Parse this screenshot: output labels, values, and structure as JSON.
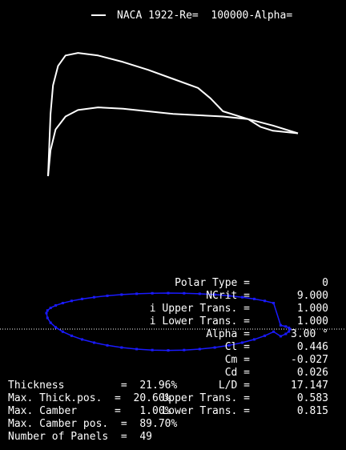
{
  "legend": {
    "label": "NACA 1922-Re=  100000-Alpha="
  },
  "colors": {
    "curve": "#ffffff",
    "airfoil": "#1a1aff",
    "chord_line": "#ffffff",
    "background": "#000000"
  },
  "chart_data": {
    "type": "line",
    "series": [
      {
        "values": [
          [
            0.0,
            0.0
          ],
          [
            0.01,
            0.48
          ],
          [
            0.02,
            0.7
          ],
          [
            0.04,
            0.85
          ],
          [
            0.07,
            0.93
          ],
          [
            0.12,
            0.95
          ],
          [
            0.2,
            0.93
          ],
          [
            0.3,
            0.88
          ],
          [
            0.4,
            0.82
          ],
          [
            0.5,
            0.75
          ],
          [
            0.6,
            0.68
          ],
          [
            0.65,
            0.6
          ],
          [
            0.7,
            0.5
          ],
          [
            0.8,
            0.44
          ],
          [
            0.9,
            0.39
          ],
          [
            1.0,
            0.33
          ]
        ]
      },
      {
        "values": [
          [
            0.0,
            0.0
          ],
          [
            0.01,
            0.2
          ],
          [
            0.03,
            0.36
          ],
          [
            0.07,
            0.46
          ],
          [
            0.12,
            0.51
          ],
          [
            0.2,
            0.53
          ],
          [
            0.3,
            0.52
          ],
          [
            0.4,
            0.5
          ],
          [
            0.5,
            0.48
          ],
          [
            0.6,
            0.47
          ],
          [
            0.7,
            0.46
          ],
          [
            0.8,
            0.44
          ],
          [
            0.85,
            0.38
          ],
          [
            0.9,
            0.35
          ],
          [
            1.0,
            0.33
          ]
        ]
      }
    ]
  },
  "stats": {
    "polar_type": {
      "label": "Polar Type =",
      "value": "0"
    },
    "ncrit": {
      "label": "NCrit =",
      "value": "9.000"
    },
    "upper_trans": {
      "label": "i Upper Trans. =",
      "value": "1.000"
    },
    "lower_trans": {
      "label": "i Lower Trans. =",
      "value": "1.000"
    },
    "alpha": {
      "label": "Alpha =",
      "value": "3.00 °"
    },
    "cl": {
      "label": "Cl =",
      "value": "0.446"
    },
    "cm": {
      "label": "Cm =",
      "value": "-0.027"
    },
    "cd": {
      "label": "Cd =",
      "value": "0.026"
    },
    "ld": {
      "label": "L/D =",
      "value": "17.147"
    },
    "upper_trans_pos": {
      "label": "Upper Trans. =",
      "value": "0.583"
    },
    "lower_trans_pos": {
      "label": "Lower Trans. =",
      "value": "0.815"
    }
  },
  "geometry": {
    "thickness": {
      "label": "Thickness         =  21.96%"
    },
    "max_thick_pos": {
      "label": "Max. Thick.pos.  =  20.60%"
    },
    "max_camber": {
      "label": "Max. Camber      =   1.00%"
    },
    "max_camber_pos": {
      "label": "Max. Camber pos.  =  89.70%"
    },
    "panels": {
      "label": "Number of Panels  =  49"
    }
  }
}
